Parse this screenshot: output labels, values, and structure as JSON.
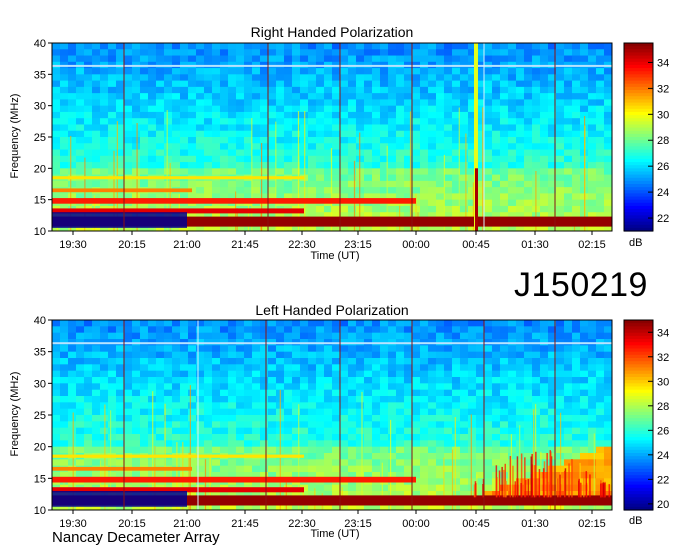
{
  "station_code": "J150219",
  "footer_label": "Nancay Decameter Array",
  "colorbar_unit": "dB",
  "chart_data": [
    {
      "type": "heatmap",
      "title": "Right Handed Polarization",
      "xlabel": "Time (UT)",
      "ylabel": "Frequency (MHz)",
      "x_ticks": [
        "19:30",
        "20:15",
        "21:00",
        "21:45",
        "22:30",
        "23:15",
        "00:00",
        "00:45",
        "01:30",
        "02:15"
      ],
      "y_ticks": [
        10,
        15,
        20,
        25,
        30,
        35,
        40
      ],
      "ylim": [
        10,
        40
      ],
      "colorbar_ticks": [
        22,
        24,
        26,
        28,
        30,
        32,
        34
      ],
      "colorbar_range": [
        21,
        35.5
      ],
      "colorbar_unit": "dB",
      "colors": {
        "low": "#00008f",
        "mid": "#1aa6e6",
        "high": "#800000"
      },
      "features": {
        "hour_markers": [
          "20:15",
          "21:45",
          "23:15",
          "00:00",
          "01:30",
          "02:15"
        ],
        "strong_interference_band_mhz": 11.5,
        "rfi_line_mhz": 36.2,
        "burst_time": "00:55"
      }
    },
    {
      "type": "heatmap",
      "title": "Left Handed Polarization",
      "xlabel": "Time (UT)",
      "ylabel": "Frequency (MHz)",
      "x_ticks": [
        "19:30",
        "20:15",
        "21:00",
        "21:45",
        "22:30",
        "23:15",
        "00:00",
        "00:45",
        "01:30",
        "02:15"
      ],
      "y_ticks": [
        10,
        15,
        20,
        25,
        30,
        35,
        40
      ],
      "ylim": [
        10,
        40
      ],
      "colorbar_ticks": [
        20,
        22,
        24,
        26,
        28,
        30,
        32,
        34
      ],
      "colorbar_range": [
        19.5,
        35
      ],
      "colorbar_unit": "dB",
      "colors": {
        "low": "#00008f",
        "mid": "#1aa6e6",
        "high": "#800000"
      },
      "features": {
        "hour_markers": [
          "20:15",
          "21:45",
          "23:15",
          "00:00",
          "01:30",
          "02:15"
        ],
        "strong_interference_band_mhz": 11.5,
        "rfi_line_mhz": 36.2,
        "emission_arc_start": "01:00",
        "emission_arc_end": "02:45"
      }
    }
  ]
}
